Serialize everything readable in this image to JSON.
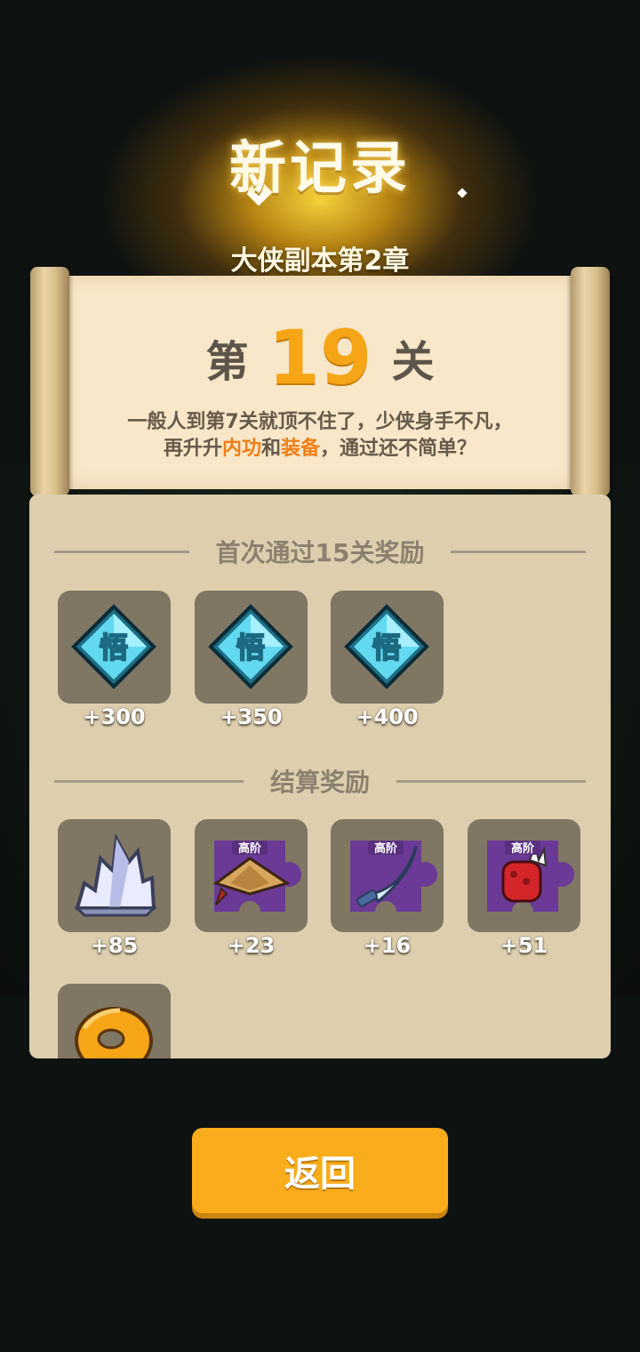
{
  "header": {
    "title": "新记录",
    "subtitle": "大侠副本第2章"
  },
  "level_card": {
    "prefix": "第",
    "number": "19",
    "suffix": "关",
    "desc_line1": "一般人到第7关就顶不住了，少侠身手不凡，",
    "desc_line2_part1": "再升升",
    "desc_highlight1": "内功",
    "desc_line2_part2": "和",
    "desc_highlight2": "装备",
    "desc_line2_part3": "，通过还不简单？"
  },
  "first_clear": {
    "title": "首次通过15关奖励",
    "items": [
      {
        "icon": "insight-gem-icon",
        "glyph": "悟",
        "amount": "+300"
      },
      {
        "icon": "insight-gem-icon",
        "glyph": "悟",
        "amount": "+350"
      },
      {
        "icon": "insight-gem-icon",
        "glyph": "悟",
        "amount": "+400"
      }
    ]
  },
  "settlement": {
    "title": "结算奖励",
    "items": [
      {
        "icon": "crystal-ore-icon",
        "amount": "+85"
      },
      {
        "icon": "straw-hat-shard-icon",
        "tag": "高阶",
        "amount": "+23"
      },
      {
        "icon": "saber-shard-icon",
        "tag": "高阶",
        "amount": "+16"
      },
      {
        "icon": "red-gauntlet-shard-icon",
        "tag": "高阶",
        "amount": "+51"
      },
      {
        "icon": "gold-ring-icon"
      }
    ]
  },
  "return_button": {
    "label": "返回"
  },
  "colors": {
    "accent_gold": "#f5a516",
    "highlight_orange": "#f07e16",
    "button_orange": "#f9ac1c",
    "panel_tan": "#ddcfae",
    "slot_gray": "#7f7664",
    "shard_purple": "#6a3a96"
  }
}
